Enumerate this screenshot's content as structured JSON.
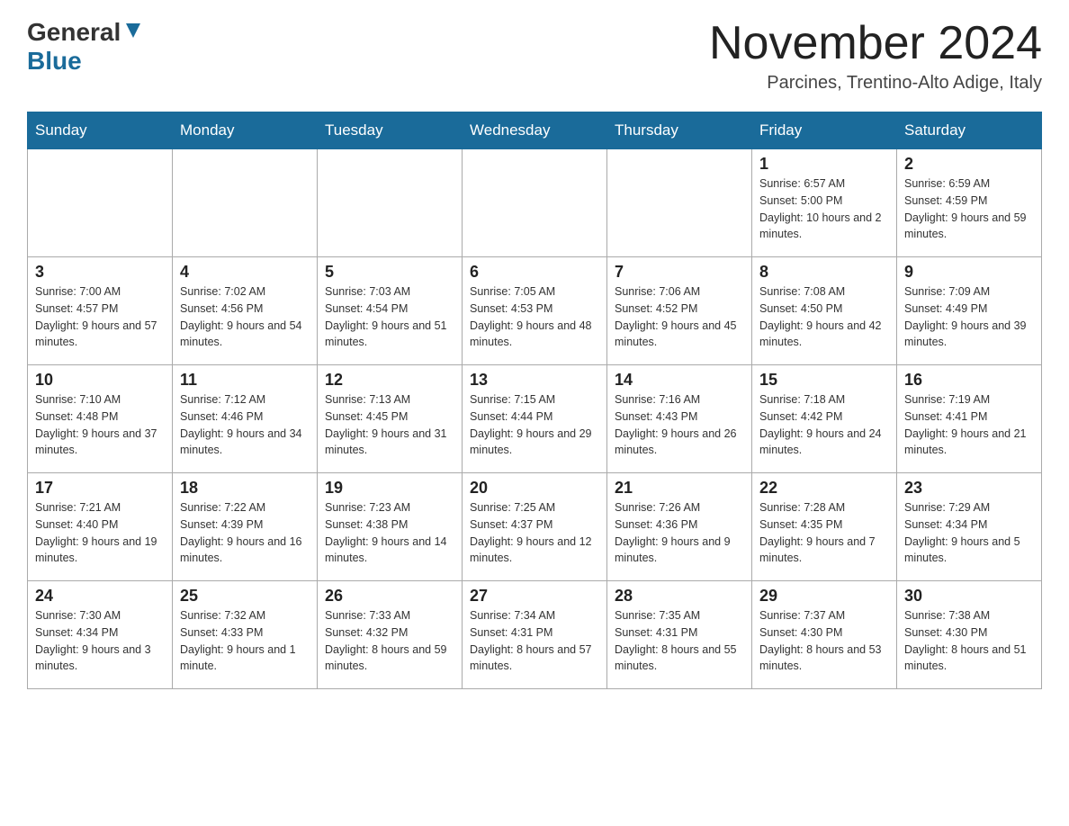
{
  "header": {
    "logo": {
      "general": "General",
      "blue": "Blue",
      "aria": "GeneralBlue logo"
    },
    "title": "November 2024",
    "location": "Parcines, Trentino-Alto Adige, Italy"
  },
  "calendar": {
    "days_of_week": [
      "Sunday",
      "Monday",
      "Tuesday",
      "Wednesday",
      "Thursday",
      "Friday",
      "Saturday"
    ],
    "weeks": [
      [
        {
          "day": "",
          "info": ""
        },
        {
          "day": "",
          "info": ""
        },
        {
          "day": "",
          "info": ""
        },
        {
          "day": "",
          "info": ""
        },
        {
          "day": "",
          "info": ""
        },
        {
          "day": "1",
          "info": "Sunrise: 6:57 AM\nSunset: 5:00 PM\nDaylight: 10 hours and 2 minutes."
        },
        {
          "day": "2",
          "info": "Sunrise: 6:59 AM\nSunset: 4:59 PM\nDaylight: 9 hours and 59 minutes."
        }
      ],
      [
        {
          "day": "3",
          "info": "Sunrise: 7:00 AM\nSunset: 4:57 PM\nDaylight: 9 hours and 57 minutes."
        },
        {
          "day": "4",
          "info": "Sunrise: 7:02 AM\nSunset: 4:56 PM\nDaylight: 9 hours and 54 minutes."
        },
        {
          "day": "5",
          "info": "Sunrise: 7:03 AM\nSunset: 4:54 PM\nDaylight: 9 hours and 51 minutes."
        },
        {
          "day": "6",
          "info": "Sunrise: 7:05 AM\nSunset: 4:53 PM\nDaylight: 9 hours and 48 minutes."
        },
        {
          "day": "7",
          "info": "Sunrise: 7:06 AM\nSunset: 4:52 PM\nDaylight: 9 hours and 45 minutes."
        },
        {
          "day": "8",
          "info": "Sunrise: 7:08 AM\nSunset: 4:50 PM\nDaylight: 9 hours and 42 minutes."
        },
        {
          "day": "9",
          "info": "Sunrise: 7:09 AM\nSunset: 4:49 PM\nDaylight: 9 hours and 39 minutes."
        }
      ],
      [
        {
          "day": "10",
          "info": "Sunrise: 7:10 AM\nSunset: 4:48 PM\nDaylight: 9 hours and 37 minutes."
        },
        {
          "day": "11",
          "info": "Sunrise: 7:12 AM\nSunset: 4:46 PM\nDaylight: 9 hours and 34 minutes."
        },
        {
          "day": "12",
          "info": "Sunrise: 7:13 AM\nSunset: 4:45 PM\nDaylight: 9 hours and 31 minutes."
        },
        {
          "day": "13",
          "info": "Sunrise: 7:15 AM\nSunset: 4:44 PM\nDaylight: 9 hours and 29 minutes."
        },
        {
          "day": "14",
          "info": "Sunrise: 7:16 AM\nSunset: 4:43 PM\nDaylight: 9 hours and 26 minutes."
        },
        {
          "day": "15",
          "info": "Sunrise: 7:18 AM\nSunset: 4:42 PM\nDaylight: 9 hours and 24 minutes."
        },
        {
          "day": "16",
          "info": "Sunrise: 7:19 AM\nSunset: 4:41 PM\nDaylight: 9 hours and 21 minutes."
        }
      ],
      [
        {
          "day": "17",
          "info": "Sunrise: 7:21 AM\nSunset: 4:40 PM\nDaylight: 9 hours and 19 minutes."
        },
        {
          "day": "18",
          "info": "Sunrise: 7:22 AM\nSunset: 4:39 PM\nDaylight: 9 hours and 16 minutes."
        },
        {
          "day": "19",
          "info": "Sunrise: 7:23 AM\nSunset: 4:38 PM\nDaylight: 9 hours and 14 minutes."
        },
        {
          "day": "20",
          "info": "Sunrise: 7:25 AM\nSunset: 4:37 PM\nDaylight: 9 hours and 12 minutes."
        },
        {
          "day": "21",
          "info": "Sunrise: 7:26 AM\nSunset: 4:36 PM\nDaylight: 9 hours and 9 minutes."
        },
        {
          "day": "22",
          "info": "Sunrise: 7:28 AM\nSunset: 4:35 PM\nDaylight: 9 hours and 7 minutes."
        },
        {
          "day": "23",
          "info": "Sunrise: 7:29 AM\nSunset: 4:34 PM\nDaylight: 9 hours and 5 minutes."
        }
      ],
      [
        {
          "day": "24",
          "info": "Sunrise: 7:30 AM\nSunset: 4:34 PM\nDaylight: 9 hours and 3 minutes."
        },
        {
          "day": "25",
          "info": "Sunrise: 7:32 AM\nSunset: 4:33 PM\nDaylight: 9 hours and 1 minute."
        },
        {
          "day": "26",
          "info": "Sunrise: 7:33 AM\nSunset: 4:32 PM\nDaylight: 8 hours and 59 minutes."
        },
        {
          "day": "27",
          "info": "Sunrise: 7:34 AM\nSunset: 4:31 PM\nDaylight: 8 hours and 57 minutes."
        },
        {
          "day": "28",
          "info": "Sunrise: 7:35 AM\nSunset: 4:31 PM\nDaylight: 8 hours and 55 minutes."
        },
        {
          "day": "29",
          "info": "Sunrise: 7:37 AM\nSunset: 4:30 PM\nDaylight: 8 hours and 53 minutes."
        },
        {
          "day": "30",
          "info": "Sunrise: 7:38 AM\nSunset: 4:30 PM\nDaylight: 8 hours and 51 minutes."
        }
      ]
    ]
  }
}
